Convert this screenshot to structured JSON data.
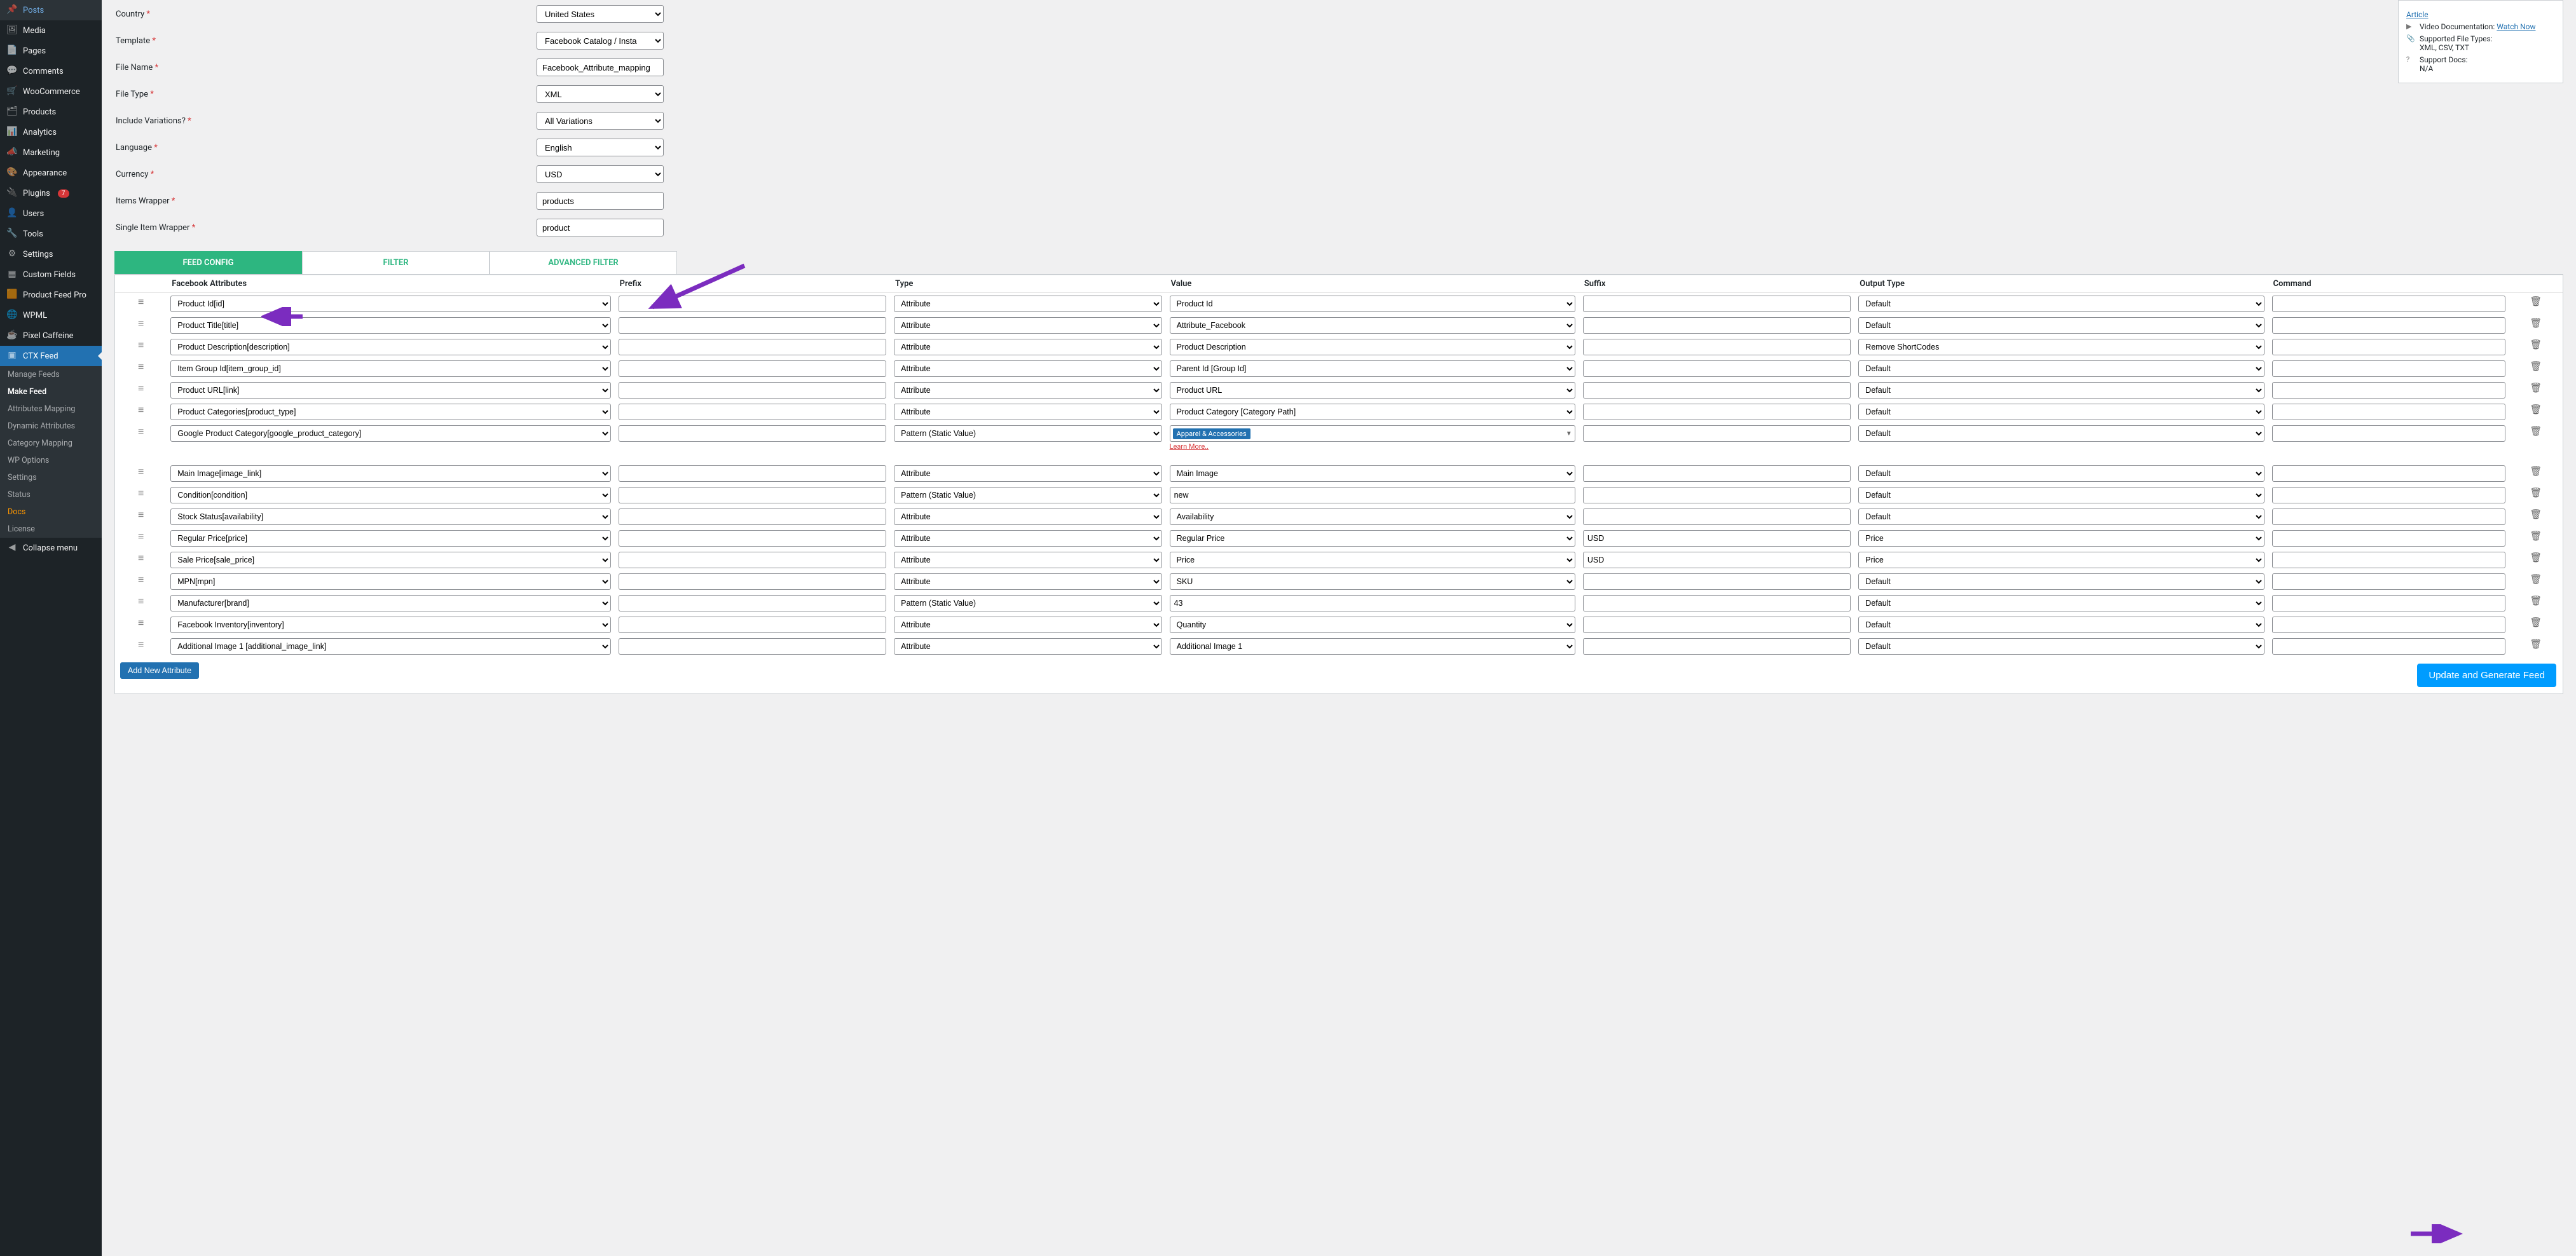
{
  "sidebar": {
    "items": [
      {
        "icon": "📌",
        "label": "Posts"
      },
      {
        "icon": "🖼",
        "label": "Media"
      },
      {
        "icon": "📄",
        "label": "Pages"
      },
      {
        "icon": "💬",
        "label": "Comments"
      },
      {
        "icon": "🛒",
        "label": "WooCommerce"
      },
      {
        "icon": "🗂",
        "label": "Products"
      },
      {
        "icon": "📊",
        "label": "Analytics"
      },
      {
        "icon": "📣",
        "label": "Marketing"
      },
      {
        "icon": "🎨",
        "label": "Appearance"
      },
      {
        "icon": "🔌",
        "label": "Plugins",
        "badge": "7"
      },
      {
        "icon": "👤",
        "label": "Users"
      },
      {
        "icon": "🔧",
        "label": "Tools"
      },
      {
        "icon": "⚙",
        "label": "Settings"
      },
      {
        "icon": "▦",
        "label": "Custom Fields"
      },
      {
        "icon": "🟧",
        "label": "Product Feed Pro"
      },
      {
        "icon": "🌐",
        "label": "WPML"
      },
      {
        "icon": "☕",
        "label": "Pixel Caffeine"
      },
      {
        "icon": "▣",
        "label": "CTX Feed",
        "active": true
      }
    ],
    "sub": [
      {
        "label": "Manage Feeds"
      },
      {
        "label": "Make Feed",
        "current": true
      },
      {
        "label": "Attributes Mapping"
      },
      {
        "label": "Dynamic Attributes"
      },
      {
        "label": "Category Mapping"
      },
      {
        "label": "WP Options"
      },
      {
        "label": "Settings"
      },
      {
        "label": "Status"
      },
      {
        "label": "Docs",
        "docs": true
      },
      {
        "label": "License"
      }
    ],
    "collapse": "Collapse menu"
  },
  "help": {
    "article": "Article",
    "video_label": "Video Documentation:",
    "video_link": "Watch Now",
    "filetypes_label": "Supported File Types:",
    "filetypes": "XML, CSV, TXT",
    "support_label": "Support Docs:",
    "support": "N/A"
  },
  "form": {
    "country": {
      "label": "Country",
      "value": "United States"
    },
    "template": {
      "label": "Template",
      "value": "Facebook Catalog / Insta"
    },
    "filename": {
      "label": "File Name",
      "value": "Facebook_Attribute_mapping"
    },
    "filetype": {
      "label": "File Type",
      "value": "XML"
    },
    "variations": {
      "label": "Include Variations?",
      "value": "All Variations"
    },
    "language": {
      "label": "Language",
      "value": "English"
    },
    "currency": {
      "label": "Currency",
      "value": "USD"
    },
    "items_wrapper": {
      "label": "Items Wrapper",
      "value": "products"
    },
    "single_wrapper": {
      "label": "Single Item Wrapper",
      "value": "product"
    }
  },
  "tabs": {
    "config": "FEED CONFIG",
    "filter": "FILTER",
    "adv": "ADVANCED FILTER"
  },
  "headers": {
    "attr": "Facebook Attributes",
    "prefix": "Prefix",
    "type": "Type",
    "value": "Value",
    "suffix": "Suffix",
    "output": "Output Type",
    "command": "Command"
  },
  "rows": [
    {
      "attr": "Product Id[id]",
      "type": "Attribute",
      "value": "Product Id",
      "suffix": "",
      "output": "Default"
    },
    {
      "attr": "Product Title[title]",
      "type": "Attribute",
      "value": "Attribute_Facebook",
      "suffix": "",
      "output": "Default"
    },
    {
      "attr": "Product Description[description]",
      "type": "Attribute",
      "value": "Product Description",
      "suffix": "",
      "output": "Remove ShortCodes"
    },
    {
      "attr": "Item Group Id[item_group_id]",
      "type": "Attribute",
      "value": "Parent Id [Group Id]",
      "suffix": "",
      "output": "Default"
    },
    {
      "attr": "Product URL[link]",
      "type": "Attribute",
      "value": "Product URL",
      "suffix": "",
      "output": "Default"
    },
    {
      "attr": "Product Categories[product_type]",
      "type": "Attribute",
      "value": "Product Category [Category Path]",
      "suffix": "",
      "output": "Default"
    },
    {
      "attr": "Google Product Category[google_product_category]",
      "type": "Pattern (Static Value)",
      "valuetag": "Apparel & Accessories",
      "learnmore": "Learn More..",
      "suffix": "",
      "output": "Default"
    },
    {
      "attr": "Main Image[image_link]",
      "type": "Attribute",
      "value": "Main Image",
      "suffix": "",
      "output": "Default",
      "gapbefore": true
    },
    {
      "attr": "Condition[condition]",
      "type": "Pattern (Static Value)",
      "valuetext": "new",
      "suffix": "",
      "output": "Default"
    },
    {
      "attr": "Stock Status[availability]",
      "type": "Attribute",
      "value": "Availability",
      "suffix": "",
      "output": "Default"
    },
    {
      "attr": "Regular Price[price]",
      "type": "Attribute",
      "value": "Regular Price",
      "suffix": "USD",
      "output": "Price"
    },
    {
      "attr": "Sale Price[sale_price]",
      "type": "Attribute",
      "value": "Price",
      "suffix": "USD",
      "output": "Price"
    },
    {
      "attr": "MPN[mpn]",
      "type": "Attribute",
      "value": "SKU",
      "suffix": "",
      "output": "Default"
    },
    {
      "attr": "Manufacturer[brand]",
      "type": "Pattern (Static Value)",
      "valuetext": "43",
      "suffix": "",
      "output": "Default"
    },
    {
      "attr": "Facebook Inventory[inventory]",
      "type": "Attribute",
      "value": "Quantity",
      "suffix": "",
      "output": "Default"
    },
    {
      "attr": "Additional Image 1 [additional_image_link]",
      "type": "Attribute",
      "value": "Additional Image 1",
      "suffix": "",
      "output": "Default"
    }
  ],
  "buttons": {
    "add": "Add New Attribute",
    "generate": "Update and Generate Feed"
  }
}
